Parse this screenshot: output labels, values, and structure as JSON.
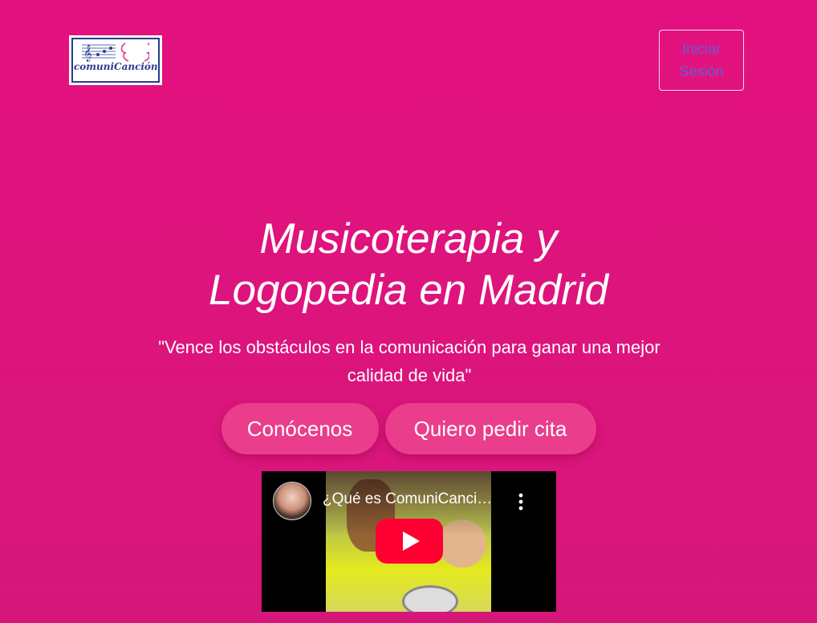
{
  "header": {
    "logo_text": "comuniCanción",
    "login_label": "Iniciar Sesión"
  },
  "hero": {
    "title_line1": "Musicoterapia y",
    "title_line2": "Logopedia en Madrid",
    "subtitle": "\"Vence los obstáculos en la comunicación para ganar una mejor calidad de vida\"",
    "cta_primary": "Conócenos",
    "cta_secondary": "Quiero pedir cita"
  },
  "video": {
    "title": "¿Qué es ComuniCanción?",
    "icons": {
      "play": "youtube-play-icon",
      "more": "more-vertical-icon",
      "avatar": "channel-avatar"
    }
  },
  "colors": {
    "background": "#e3117f",
    "cta": "#ea3d8b",
    "login_text": "#6a5bd6",
    "youtube_red": "#ff0033"
  }
}
